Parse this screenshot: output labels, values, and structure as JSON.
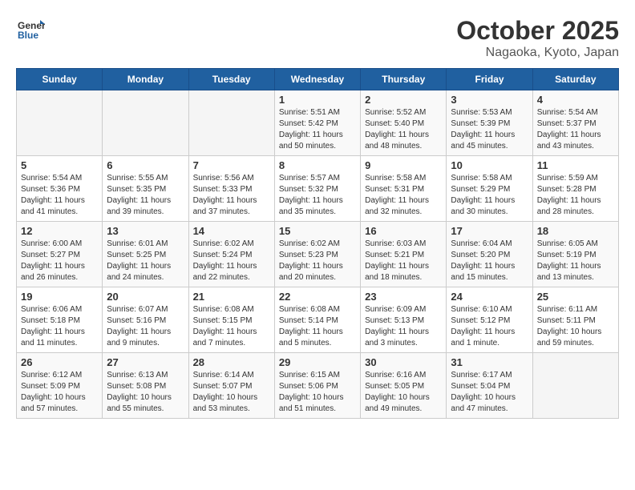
{
  "header": {
    "logo_general": "General",
    "logo_blue": "Blue",
    "title": "October 2025",
    "subtitle": "Nagaoka, Kyoto, Japan"
  },
  "weekdays": [
    "Sunday",
    "Monday",
    "Tuesday",
    "Wednesday",
    "Thursday",
    "Friday",
    "Saturday"
  ],
  "weeks": [
    [
      {
        "day": "",
        "info": ""
      },
      {
        "day": "",
        "info": ""
      },
      {
        "day": "",
        "info": ""
      },
      {
        "day": "1",
        "info": "Sunrise: 5:51 AM\nSunset: 5:42 PM\nDaylight: 11 hours\nand 50 minutes."
      },
      {
        "day": "2",
        "info": "Sunrise: 5:52 AM\nSunset: 5:40 PM\nDaylight: 11 hours\nand 48 minutes."
      },
      {
        "day": "3",
        "info": "Sunrise: 5:53 AM\nSunset: 5:39 PM\nDaylight: 11 hours\nand 45 minutes."
      },
      {
        "day": "4",
        "info": "Sunrise: 5:54 AM\nSunset: 5:37 PM\nDaylight: 11 hours\nand 43 minutes."
      }
    ],
    [
      {
        "day": "5",
        "info": "Sunrise: 5:54 AM\nSunset: 5:36 PM\nDaylight: 11 hours\nand 41 minutes."
      },
      {
        "day": "6",
        "info": "Sunrise: 5:55 AM\nSunset: 5:35 PM\nDaylight: 11 hours\nand 39 minutes."
      },
      {
        "day": "7",
        "info": "Sunrise: 5:56 AM\nSunset: 5:33 PM\nDaylight: 11 hours\nand 37 minutes."
      },
      {
        "day": "8",
        "info": "Sunrise: 5:57 AM\nSunset: 5:32 PM\nDaylight: 11 hours\nand 35 minutes."
      },
      {
        "day": "9",
        "info": "Sunrise: 5:58 AM\nSunset: 5:31 PM\nDaylight: 11 hours\nand 32 minutes."
      },
      {
        "day": "10",
        "info": "Sunrise: 5:58 AM\nSunset: 5:29 PM\nDaylight: 11 hours\nand 30 minutes."
      },
      {
        "day": "11",
        "info": "Sunrise: 5:59 AM\nSunset: 5:28 PM\nDaylight: 11 hours\nand 28 minutes."
      }
    ],
    [
      {
        "day": "12",
        "info": "Sunrise: 6:00 AM\nSunset: 5:27 PM\nDaylight: 11 hours\nand 26 minutes."
      },
      {
        "day": "13",
        "info": "Sunrise: 6:01 AM\nSunset: 5:25 PM\nDaylight: 11 hours\nand 24 minutes."
      },
      {
        "day": "14",
        "info": "Sunrise: 6:02 AM\nSunset: 5:24 PM\nDaylight: 11 hours\nand 22 minutes."
      },
      {
        "day": "15",
        "info": "Sunrise: 6:02 AM\nSunset: 5:23 PM\nDaylight: 11 hours\nand 20 minutes."
      },
      {
        "day": "16",
        "info": "Sunrise: 6:03 AM\nSunset: 5:21 PM\nDaylight: 11 hours\nand 18 minutes."
      },
      {
        "day": "17",
        "info": "Sunrise: 6:04 AM\nSunset: 5:20 PM\nDaylight: 11 hours\nand 15 minutes."
      },
      {
        "day": "18",
        "info": "Sunrise: 6:05 AM\nSunset: 5:19 PM\nDaylight: 11 hours\nand 13 minutes."
      }
    ],
    [
      {
        "day": "19",
        "info": "Sunrise: 6:06 AM\nSunset: 5:18 PM\nDaylight: 11 hours\nand 11 minutes."
      },
      {
        "day": "20",
        "info": "Sunrise: 6:07 AM\nSunset: 5:16 PM\nDaylight: 11 hours\nand 9 minutes."
      },
      {
        "day": "21",
        "info": "Sunrise: 6:08 AM\nSunset: 5:15 PM\nDaylight: 11 hours\nand 7 minutes."
      },
      {
        "day": "22",
        "info": "Sunrise: 6:08 AM\nSunset: 5:14 PM\nDaylight: 11 hours\nand 5 minutes."
      },
      {
        "day": "23",
        "info": "Sunrise: 6:09 AM\nSunset: 5:13 PM\nDaylight: 11 hours\nand 3 minutes."
      },
      {
        "day": "24",
        "info": "Sunrise: 6:10 AM\nSunset: 5:12 PM\nDaylight: 11 hours\nand 1 minute."
      },
      {
        "day": "25",
        "info": "Sunrise: 6:11 AM\nSunset: 5:11 PM\nDaylight: 10 hours\nand 59 minutes."
      }
    ],
    [
      {
        "day": "26",
        "info": "Sunrise: 6:12 AM\nSunset: 5:09 PM\nDaylight: 10 hours\nand 57 minutes."
      },
      {
        "day": "27",
        "info": "Sunrise: 6:13 AM\nSunset: 5:08 PM\nDaylight: 10 hours\nand 55 minutes."
      },
      {
        "day": "28",
        "info": "Sunrise: 6:14 AM\nSunset: 5:07 PM\nDaylight: 10 hours\nand 53 minutes."
      },
      {
        "day": "29",
        "info": "Sunrise: 6:15 AM\nSunset: 5:06 PM\nDaylight: 10 hours\nand 51 minutes."
      },
      {
        "day": "30",
        "info": "Sunrise: 6:16 AM\nSunset: 5:05 PM\nDaylight: 10 hours\nand 49 minutes."
      },
      {
        "day": "31",
        "info": "Sunrise: 6:17 AM\nSunset: 5:04 PM\nDaylight: 10 hours\nand 47 minutes."
      },
      {
        "day": "",
        "info": ""
      }
    ]
  ]
}
